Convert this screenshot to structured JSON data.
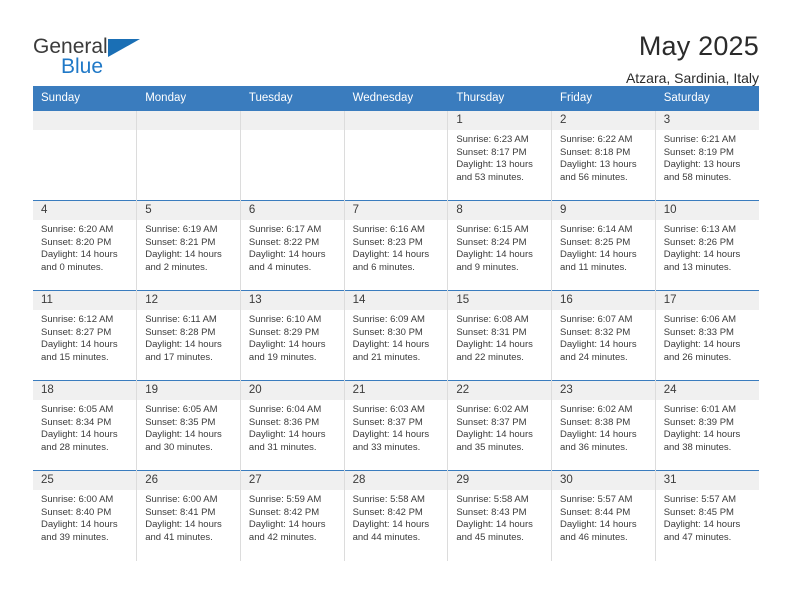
{
  "brand": {
    "name_top": "General",
    "name_bottom": "Blue",
    "triangle_color": "#1a6fb5",
    "text_color": "#3b3b3b",
    "blue_color": "#2079c7"
  },
  "header": {
    "title": "May 2025",
    "subtitle": "Atzara, Sardinia, Italy"
  },
  "theme": {
    "header_bg": "#3a7cbe",
    "header_text": "#ffffff",
    "daynum_bg": "#f0f0f0",
    "grid_line": "#dcdcdc",
    "body_text": "#3b3b3b"
  },
  "weekdays": [
    "Sunday",
    "Monday",
    "Tuesday",
    "Wednesday",
    "Thursday",
    "Friday",
    "Saturday"
  ],
  "labels": {
    "sunrise": "Sunrise:",
    "sunset": "Sunset:",
    "daylight": "Daylight:"
  },
  "weeks": [
    [
      {
        "day": "",
        "blank": true
      },
      {
        "day": "",
        "blank": true
      },
      {
        "day": "",
        "blank": true
      },
      {
        "day": "",
        "blank": true
      },
      {
        "day": "1",
        "sunrise": "Sunrise: 6:23 AM",
        "sunset": "Sunset: 8:17 PM",
        "daylight_a": "Daylight: 13 hours",
        "daylight_b": "and 53 minutes."
      },
      {
        "day": "2",
        "sunrise": "Sunrise: 6:22 AM",
        "sunset": "Sunset: 8:18 PM",
        "daylight_a": "Daylight: 13 hours",
        "daylight_b": "and 56 minutes."
      },
      {
        "day": "3",
        "sunrise": "Sunrise: 6:21 AM",
        "sunset": "Sunset: 8:19 PM",
        "daylight_a": "Daylight: 13 hours",
        "daylight_b": "and 58 minutes."
      }
    ],
    [
      {
        "day": "4",
        "sunrise": "Sunrise: 6:20 AM",
        "sunset": "Sunset: 8:20 PM",
        "daylight_a": "Daylight: 14 hours",
        "daylight_b": "and 0 minutes."
      },
      {
        "day": "5",
        "sunrise": "Sunrise: 6:19 AM",
        "sunset": "Sunset: 8:21 PM",
        "daylight_a": "Daylight: 14 hours",
        "daylight_b": "and 2 minutes."
      },
      {
        "day": "6",
        "sunrise": "Sunrise: 6:17 AM",
        "sunset": "Sunset: 8:22 PM",
        "daylight_a": "Daylight: 14 hours",
        "daylight_b": "and 4 minutes."
      },
      {
        "day": "7",
        "sunrise": "Sunrise: 6:16 AM",
        "sunset": "Sunset: 8:23 PM",
        "daylight_a": "Daylight: 14 hours",
        "daylight_b": "and 6 minutes."
      },
      {
        "day": "8",
        "sunrise": "Sunrise: 6:15 AM",
        "sunset": "Sunset: 8:24 PM",
        "daylight_a": "Daylight: 14 hours",
        "daylight_b": "and 9 minutes."
      },
      {
        "day": "9",
        "sunrise": "Sunrise: 6:14 AM",
        "sunset": "Sunset: 8:25 PM",
        "daylight_a": "Daylight: 14 hours",
        "daylight_b": "and 11 minutes."
      },
      {
        "day": "10",
        "sunrise": "Sunrise: 6:13 AM",
        "sunset": "Sunset: 8:26 PM",
        "daylight_a": "Daylight: 14 hours",
        "daylight_b": "and 13 minutes."
      }
    ],
    [
      {
        "day": "11",
        "sunrise": "Sunrise: 6:12 AM",
        "sunset": "Sunset: 8:27 PM",
        "daylight_a": "Daylight: 14 hours",
        "daylight_b": "and 15 minutes."
      },
      {
        "day": "12",
        "sunrise": "Sunrise: 6:11 AM",
        "sunset": "Sunset: 8:28 PM",
        "daylight_a": "Daylight: 14 hours",
        "daylight_b": "and 17 minutes."
      },
      {
        "day": "13",
        "sunrise": "Sunrise: 6:10 AM",
        "sunset": "Sunset: 8:29 PM",
        "daylight_a": "Daylight: 14 hours",
        "daylight_b": "and 19 minutes."
      },
      {
        "day": "14",
        "sunrise": "Sunrise: 6:09 AM",
        "sunset": "Sunset: 8:30 PM",
        "daylight_a": "Daylight: 14 hours",
        "daylight_b": "and 21 minutes."
      },
      {
        "day": "15",
        "sunrise": "Sunrise: 6:08 AM",
        "sunset": "Sunset: 8:31 PM",
        "daylight_a": "Daylight: 14 hours",
        "daylight_b": "and 22 minutes."
      },
      {
        "day": "16",
        "sunrise": "Sunrise: 6:07 AM",
        "sunset": "Sunset: 8:32 PM",
        "daylight_a": "Daylight: 14 hours",
        "daylight_b": "and 24 minutes."
      },
      {
        "day": "17",
        "sunrise": "Sunrise: 6:06 AM",
        "sunset": "Sunset: 8:33 PM",
        "daylight_a": "Daylight: 14 hours",
        "daylight_b": "and 26 minutes."
      }
    ],
    [
      {
        "day": "18",
        "sunrise": "Sunrise: 6:05 AM",
        "sunset": "Sunset: 8:34 PM",
        "daylight_a": "Daylight: 14 hours",
        "daylight_b": "and 28 minutes."
      },
      {
        "day": "19",
        "sunrise": "Sunrise: 6:05 AM",
        "sunset": "Sunset: 8:35 PM",
        "daylight_a": "Daylight: 14 hours",
        "daylight_b": "and 30 minutes."
      },
      {
        "day": "20",
        "sunrise": "Sunrise: 6:04 AM",
        "sunset": "Sunset: 8:36 PM",
        "daylight_a": "Daylight: 14 hours",
        "daylight_b": "and 31 minutes."
      },
      {
        "day": "21",
        "sunrise": "Sunrise: 6:03 AM",
        "sunset": "Sunset: 8:37 PM",
        "daylight_a": "Daylight: 14 hours",
        "daylight_b": "and 33 minutes."
      },
      {
        "day": "22",
        "sunrise": "Sunrise: 6:02 AM",
        "sunset": "Sunset: 8:37 PM",
        "daylight_a": "Daylight: 14 hours",
        "daylight_b": "and 35 minutes."
      },
      {
        "day": "23",
        "sunrise": "Sunrise: 6:02 AM",
        "sunset": "Sunset: 8:38 PM",
        "daylight_a": "Daylight: 14 hours",
        "daylight_b": "and 36 minutes."
      },
      {
        "day": "24",
        "sunrise": "Sunrise: 6:01 AM",
        "sunset": "Sunset: 8:39 PM",
        "daylight_a": "Daylight: 14 hours",
        "daylight_b": "and 38 minutes."
      }
    ],
    [
      {
        "day": "25",
        "sunrise": "Sunrise: 6:00 AM",
        "sunset": "Sunset: 8:40 PM",
        "daylight_a": "Daylight: 14 hours",
        "daylight_b": "and 39 minutes."
      },
      {
        "day": "26",
        "sunrise": "Sunrise: 6:00 AM",
        "sunset": "Sunset: 8:41 PM",
        "daylight_a": "Daylight: 14 hours",
        "daylight_b": "and 41 minutes."
      },
      {
        "day": "27",
        "sunrise": "Sunrise: 5:59 AM",
        "sunset": "Sunset: 8:42 PM",
        "daylight_a": "Daylight: 14 hours",
        "daylight_b": "and 42 minutes."
      },
      {
        "day": "28",
        "sunrise": "Sunrise: 5:58 AM",
        "sunset": "Sunset: 8:42 PM",
        "daylight_a": "Daylight: 14 hours",
        "daylight_b": "and 44 minutes."
      },
      {
        "day": "29",
        "sunrise": "Sunrise: 5:58 AM",
        "sunset": "Sunset: 8:43 PM",
        "daylight_a": "Daylight: 14 hours",
        "daylight_b": "and 45 minutes."
      },
      {
        "day": "30",
        "sunrise": "Sunrise: 5:57 AM",
        "sunset": "Sunset: 8:44 PM",
        "daylight_a": "Daylight: 14 hours",
        "daylight_b": "and 46 minutes."
      },
      {
        "day": "31",
        "sunrise": "Sunrise: 5:57 AM",
        "sunset": "Sunset: 8:45 PM",
        "daylight_a": "Daylight: 14 hours",
        "daylight_b": "and 47 minutes."
      }
    ]
  ]
}
